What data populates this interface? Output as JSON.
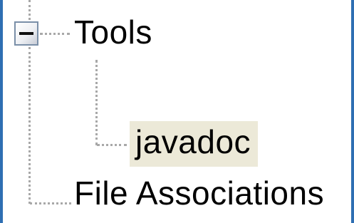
{
  "tree": {
    "nodes": [
      {
        "label": "Tools",
        "expanded": true,
        "expander_icon": "minus-box-icon"
      },
      {
        "label": "javadoc",
        "selected": true
      },
      {
        "label": "File Associations"
      }
    ]
  },
  "colors": {
    "frame": "#2f6fb3",
    "selection_bg": "#ece9d8",
    "connector": "#a8a8a8"
  }
}
